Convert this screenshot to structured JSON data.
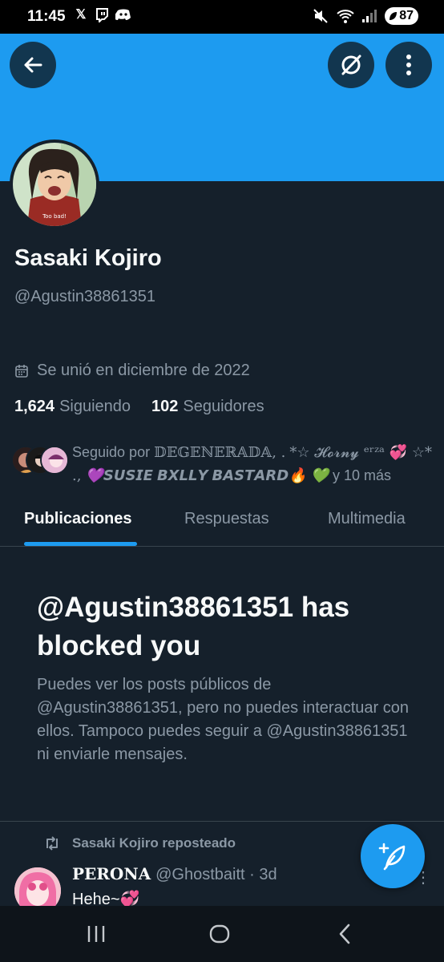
{
  "status_bar": {
    "time": "11:45",
    "battery": "87"
  },
  "profile": {
    "name": "Sasaki Kojiro",
    "handle": "@Agustin38861351",
    "joined": "Se unió en diciembre de 2022",
    "following_count": "1,624",
    "following_label": "Siguiendo",
    "followers_count": "102",
    "followers_label": "Seguidores",
    "avatar_caption": "Too bad!"
  },
  "followed_by": {
    "prefix": "Seguido por",
    "name1": "𝔻𝔼𝔾𝔼ℕ𝔼ℝ𝔸𝔻𝔸, .",
    "name2": "*☆ 𝓗𝓸𝓻𝓷𝔂 ᵉʳᶻᵃ 💞 ☆* .,",
    "name3": "💜𝙎𝙐𝙎𝙄𝙀 𝘽𝙓𝙇𝙇𝙔 𝘽𝘼𝙎𝙏𝘼𝙍𝘿🔥 💚",
    "suffix": "y 10 más"
  },
  "tabs": [
    {
      "label": "Publicaciones"
    },
    {
      "label": "Respuestas"
    },
    {
      "label": "Multimedia"
    }
  ],
  "blocked": {
    "title": "@Agustin38861351 has blocked you",
    "body": "Puedes ver los posts públicos de @Agustin38861351, pero no puedes interactuar con ellos. Tampoco puedes seguir a @Agustin38861351 ni enviarle mensajes."
  },
  "post": {
    "repost_label": "Sasaki Kojiro reposteado",
    "author_name": "𝐏𝐄𝐑𝐎𝐍𝐀",
    "author_handle": "@Ghostbaitt",
    "time": "· 3d",
    "text": "Hehe~💞"
  },
  "colors": {
    "background": "#15202b",
    "banner": "#1d9bf0",
    "accent": "#1d9bf0",
    "muted_text": "#8b98a5"
  }
}
